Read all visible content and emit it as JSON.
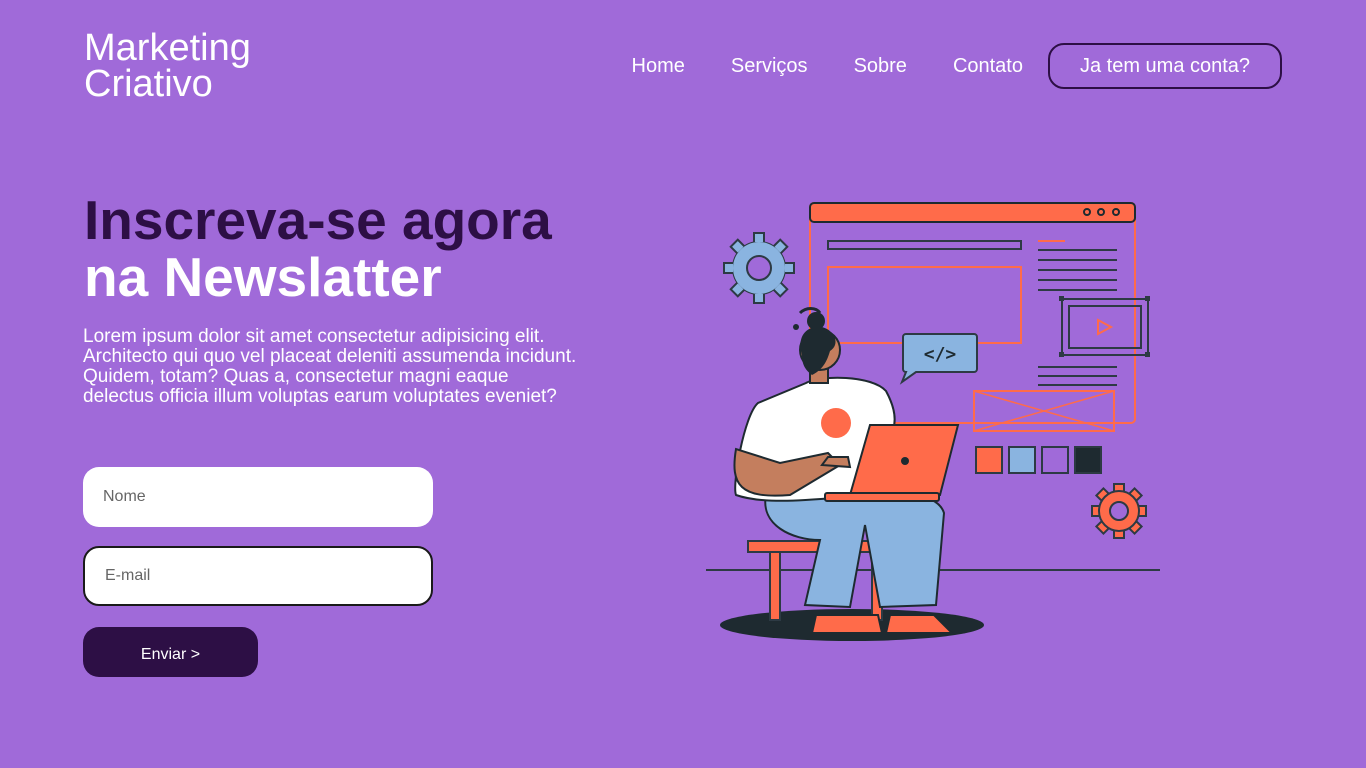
{
  "header": {
    "logo_line1": "Marketing",
    "logo_line2": "Criativo",
    "nav": [
      "Home",
      "Serviços",
      "Sobre",
      "Contato"
    ],
    "account_button": "Ja tem uma conta?"
  },
  "hero": {
    "title_line1": "Inscreva-se agora",
    "title_line2": "na Newslatter",
    "text": "Lorem ipsum dolor sit amet consectetur adipisicing elit. Architecto qui quo vel placeat deleniti assumenda incidunt. Quidem, totam? Quas a, consectetur magni eaque delectus officia illum voluptas earum voluptates eveniet?"
  },
  "form": {
    "name_placeholder": "Nome",
    "email_placeholder": "E-mail",
    "submit_label": "Enviar >"
  },
  "illustration": {
    "code_tag": "</>"
  },
  "colors": {
    "background": "#a06ad9",
    "dark_purple": "#2d0f45",
    "accent": "#ff6b4a",
    "light_blue": "#8ab4e0"
  }
}
